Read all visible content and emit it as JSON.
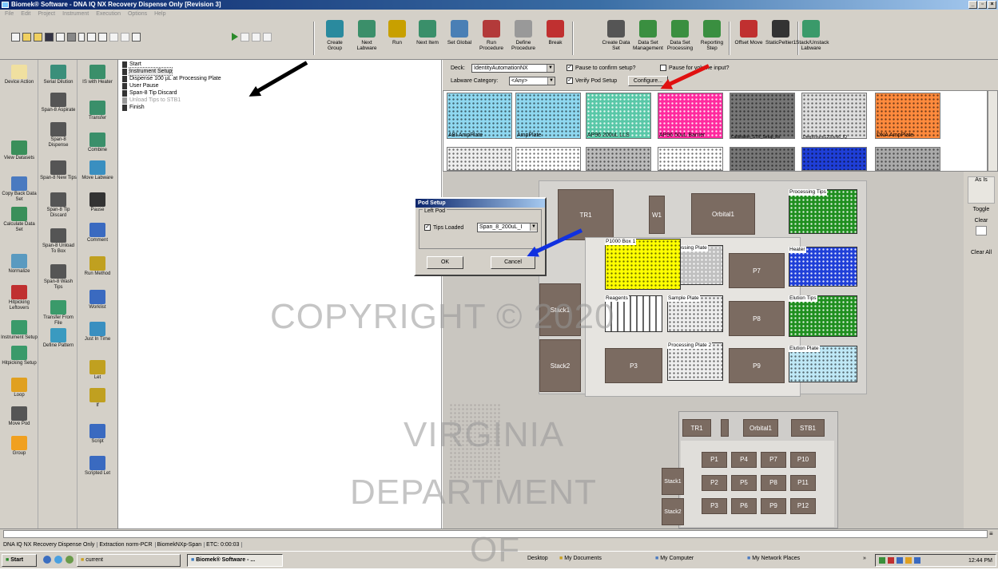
{
  "window": {
    "title": "Biomek® Software - DNA IQ NX Recovery Dispense Only [Revision 3]"
  },
  "menu": [
    "File",
    "Edit",
    "Project",
    "Instrument",
    "Execution",
    "Options",
    "Help"
  ],
  "toolbar": {
    "buttons": [
      "Create Group",
      "Next Labware",
      "Run",
      "Next Item",
      "Set Global",
      "Run Procedure",
      "Define Procedure",
      "Break",
      "Create Data Set",
      "Data Set Management",
      "Data Set Processing",
      "Reporting Step",
      "Offset Move",
      "StaticPeltier1",
      "Stack/Unstack Labware"
    ],
    "colors": [
      "#2a8a9e",
      "#3b8f6a",
      "#c8a000",
      "#3a8f6a",
      "#4a7fb5",
      "#b33a3a",
      "#999999",
      "#c03030",
      "#555555",
      "#3a8f40",
      "#3a8f40",
      "#3a8f40",
      "#c03030",
      "#333333",
      "#3a9a6a"
    ]
  },
  "palette": {
    "col1": [
      "Device Action",
      "View Datasets",
      "Copy Back Data Set",
      "Calculate Data Set",
      "Normalize",
      "Hitpicking Leftovers",
      "Instrument Setup",
      "Hitpicking Setup",
      "Loop",
      "Move Pod",
      "Group"
    ],
    "col2": [
      "Serial Dilution",
      "Span-8 Aspirate",
      "Span-8 Dispense",
      "Span-8 New Tips",
      "Span-8 Tip Discard",
      "Span-8 Unload To Box",
      "Span-8 Wash Tips",
      "Transfer From File",
      "Define Pattern"
    ],
    "col3": [
      "IS with Heater",
      "Transfer",
      "Combine",
      "Move Labware",
      "Pause",
      "Comment",
      "Run Method",
      "Worklist",
      "Just In Time",
      "Let",
      "If",
      "Script",
      "Scripted Let"
    ]
  },
  "tree": [
    {
      "label": "Start",
      "grey": false
    },
    {
      "label": "Instrument Setup",
      "grey": false,
      "selected": true
    },
    {
      "label": "Dispense 100 µL at Processing Plate",
      "grey": false
    },
    {
      "label": "User Pause",
      "grey": false
    },
    {
      "label": "Span-8 Tip Discard",
      "grey": false
    },
    {
      "label": "Unload Tips to STB1",
      "grey": true
    },
    {
      "label": "Finish",
      "grey": false
    }
  ],
  "deck_options": {
    "deck_label": "Deck:",
    "deck_value": "IdentityAutomationNX",
    "category_label": "Labware Category:",
    "category_value": "<Any>",
    "pause_label": "Pause to confirm setup?",
    "pause_checked": true,
    "pause_input_label": "Pause for volume input?",
    "pause_input_checked": false,
    "verify_label": "Verify Pod Setup",
    "verify_checked": true,
    "configure_label": "Configure..."
  },
  "labware": [
    "ABI AmpPlate",
    "AmpPlate",
    "AP96 200uL LLS",
    "AP96 50uL Barrier",
    "Calibration_STR_Setup_Rx",
    "DeepRound1200uN6_IQ",
    "DNA AmpPlate"
  ],
  "labware_colors": [
    "#8fd8f0",
    "#8fd8f0",
    "#59c8a8",
    "#ff2a9e",
    "#777777",
    "#dddddd",
    "#ff8a3d"
  ],
  "right_tools": [
    "As Is",
    "Toggle",
    "Clear",
    "Clear All"
  ],
  "deck": {
    "positions": [
      "TR1",
      "W1",
      "Orbital1",
      "Stack1",
      "Stack2",
      "P7",
      "P8",
      "P9",
      "P3"
    ],
    "labware": [
      "Processing Tips",
      "P1000 Box 1",
      "Processing Plate",
      "Heater",
      "Reagents",
      "Sample Plate",
      "Elution Tips",
      "Processing Plate 2",
      "Elution Plate"
    ]
  },
  "minideck": {
    "top": [
      "TR1",
      "Orbital1",
      "STB1"
    ],
    "stacks": [
      "Stack1",
      "Stack2"
    ],
    "grid": [
      "P1",
      "P4",
      "P7",
      "P10",
      "P2",
      "P5",
      "P8",
      "P11",
      "P3",
      "P6",
      "P9",
      "P12"
    ]
  },
  "pod_dialog": {
    "title": "Pod Setup",
    "group": "Left Pod",
    "tips_label": "Tips Loaded",
    "tips_checked": true,
    "tips_value": "Span_8_200uL_I",
    "ok": "OK",
    "cancel": "Cancel"
  },
  "statusbar": [
    "DNA IQ NX Recovery Dispense Only",
    "Extraction norm-PCR",
    "BiomekNXp-Span",
    "ETC: 0:00:03"
  ],
  "taskbar": {
    "start": "Start",
    "items": [
      "current",
      "Biomek® Software - ...",
      "Desktop",
      "My Documents",
      "My Computer",
      "My Network Places"
    ],
    "clock": "12:44 PM"
  },
  "watermark": [
    "COPYRIGHT © 2020",
    "VIRGINIA",
    "DEPARTMENT",
    "OF"
  ]
}
